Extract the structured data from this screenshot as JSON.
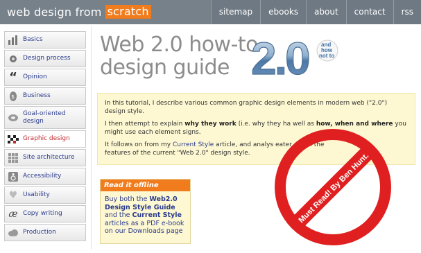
{
  "header": {
    "logo_text": "web design from",
    "logo_brand": "scratch",
    "nav": [
      "sitemap",
      "ebooks",
      "about",
      "contact",
      "rss"
    ]
  },
  "sidebar": {
    "items": [
      {
        "label": "Basics",
        "icon": "bar-chart-icon"
      },
      {
        "label": "Design process",
        "icon": "gear-icon"
      },
      {
        "label": "Opinion",
        "icon": "quote-icon"
      },
      {
        "label": "Business",
        "icon": "money-icon"
      },
      {
        "label": "Goal-oriented design",
        "icon": "target-icon"
      },
      {
        "label": "Graphic design",
        "icon": "checker-icon",
        "active": true
      },
      {
        "label": "Site architecture",
        "icon": "grid-icon"
      },
      {
        "label": "Accessibility",
        "icon": "wheelchair-icon"
      },
      {
        "label": "Usability",
        "icon": "heart-icon"
      },
      {
        "label": "Copy writing",
        "icon": "script-icon"
      },
      {
        "label": "Production",
        "icon": "cloud-icon"
      }
    ]
  },
  "main": {
    "title_line1": "Web 2.0 how-to",
    "title_line2": "design guide",
    "badge": {
      "big": "2.0",
      "small1": "and",
      "small2": "how",
      "small3": "not to"
    },
    "intro": {
      "p1": "In this tutorial, I describe various common graphic design elements in modern web (\"2.0\") design style.",
      "p2_pre": "I then attempt to explain ",
      "p2_b1": "why they work",
      "p2_mid": " (i.e. why they ha",
      "p2_end": "well as ",
      "p2_b2": "how, when and where",
      "p2_post": " you might use each element",
      "p2_tail": "signs.",
      "p3_pre": "It follows on from my ",
      "p3_link": "Current Style",
      "p3_mid": " article, and analys",
      "p3_mid2": "eater depth the",
      "p3_line2": "features of the current \"Web 2.0\" design style."
    },
    "offline": {
      "heading": "Read it offline",
      "t1": "Buy both the ",
      "b1": "Web2.0 Design Style Guide",
      "t2": " and the ",
      "b2": "Current Style",
      "t3": " articles as a PDF e-book on our Downloads page"
    },
    "stamp_text": "Must Read! By Ben Hunt."
  },
  "colors": {
    "header_bg": "#77818a",
    "brand_orange": "#f17c1e",
    "link_blue": "#2a3a8c",
    "active_red": "#c0272d",
    "note_bg": "#fdf8d2",
    "stamp_red": "#e02020"
  }
}
